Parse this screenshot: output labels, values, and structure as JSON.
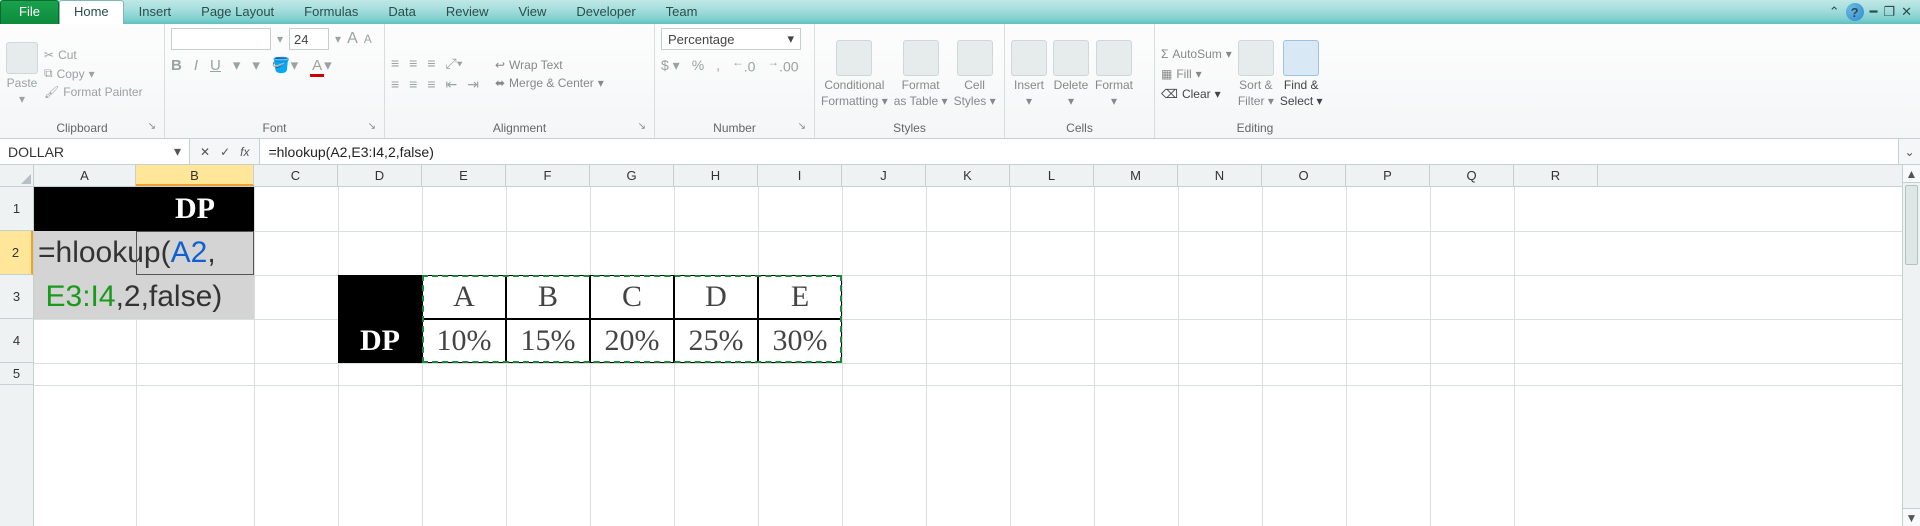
{
  "tabs": {
    "file": "File",
    "home": "Home",
    "insert": "Insert",
    "pagelayout": "Page Layout",
    "formulas": "Formulas",
    "data": "Data",
    "review": "Review",
    "view": "View",
    "developer": "Developer",
    "team": "Team"
  },
  "clipboard": {
    "paste": "Paste",
    "cut": "Cut",
    "copy": "Copy",
    "formatpainter": "Format Painter",
    "label": "Clipboard"
  },
  "font": {
    "size": "24",
    "bold": "B",
    "italic": "I",
    "underline": "U",
    "label": "Font"
  },
  "alignment": {
    "wrap": "Wrap Text",
    "merge": "Merge & Center",
    "label": "Alignment"
  },
  "number": {
    "format": "Percentage",
    "dollar": "$",
    "percent": "%",
    "comma": ",",
    "incdec": ".0 0",
    "decdec": ".00",
    "label": "Number"
  },
  "styles": {
    "cond": "Conditional",
    "cond2": "Formatting",
    "fmt": "Format",
    "fmt2": "as Table",
    "cell": "Cell",
    "cell2": "Styles",
    "label": "Styles"
  },
  "cellsgrp": {
    "insert": "Insert",
    "delete": "Delete",
    "format": "Format",
    "label": "Cells"
  },
  "editing": {
    "autosum": "AutoSum",
    "fill": "Fill",
    "clear": "Clear",
    "sort": "Sort &",
    "sort2": "Filter",
    "find": "Find &",
    "find2": "Select",
    "label": "Editing"
  },
  "namebox": "DOLLAR",
  "formula": "=hlookup(A2,E3:I4,2,false)",
  "colheads": [
    "A",
    "B",
    "C",
    "D",
    "E",
    "F",
    "G",
    "H",
    "I",
    "J",
    "K",
    "L",
    "M",
    "N",
    "O",
    "P",
    "Q",
    "R"
  ],
  "rowheads": [
    "1",
    "2",
    "3",
    "4",
    "5"
  ],
  "cells": {
    "B1": "DP",
    "A2_pre": "=hlookup(",
    "A2_ref": "A2",
    "A2_post": ",",
    "A3_ref": "E3:I4",
    "A3_post": ",2,false)",
    "D4": "DP",
    "E3": "A",
    "F3": "B",
    "G3": "C",
    "H3": "D",
    "I3": "E",
    "E4": "10%",
    "F4": "15%",
    "G4": "20%",
    "H4": "25%",
    "I4": "30%"
  }
}
